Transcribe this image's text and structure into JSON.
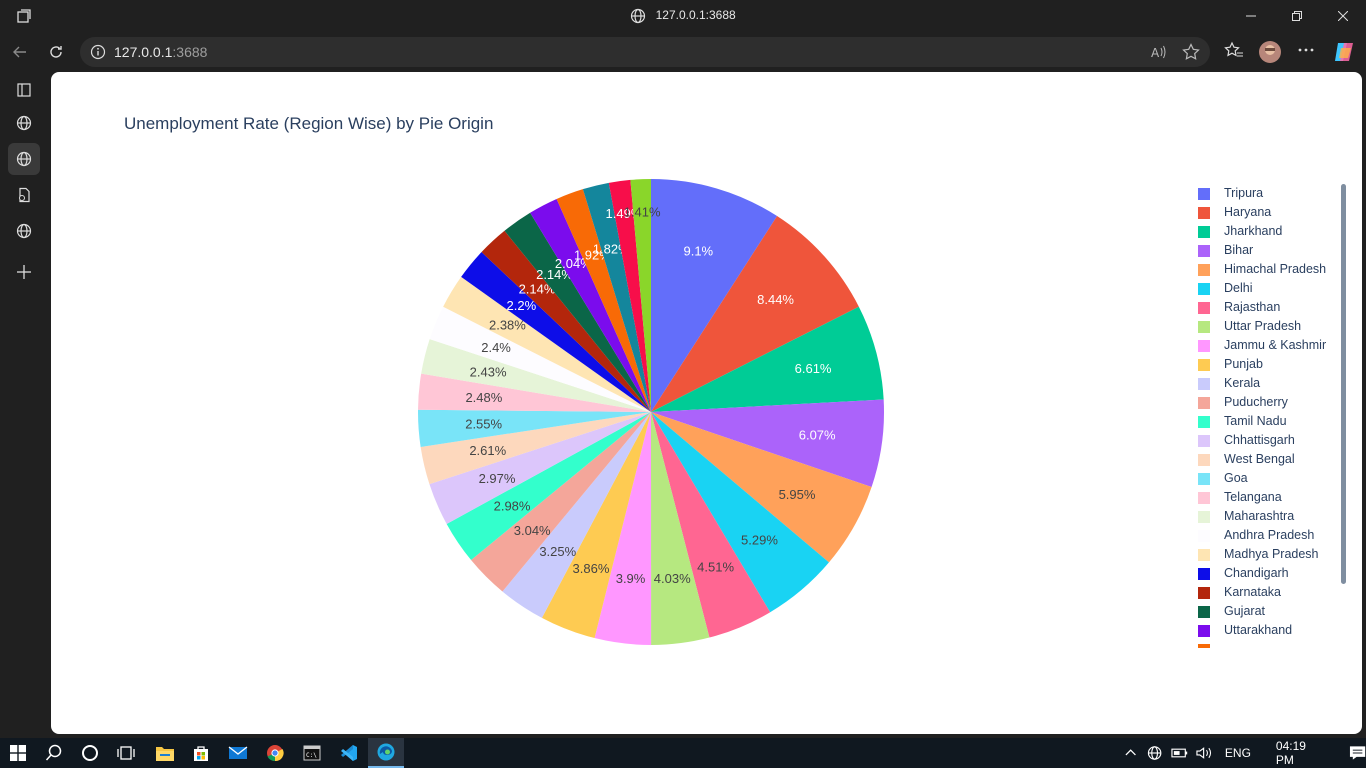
{
  "window": {
    "title": "127.0.0.1:3688"
  },
  "address_bar": {
    "url_host": "127.0.0.1",
    "url_port": ":3688"
  },
  "chart_data": {
    "type": "pie",
    "title": "Unemployment Rate (Region Wise) by Pie Origin",
    "slices": [
      {
        "label": "Tripura",
        "value": 9.1,
        "text": "9.1%",
        "color": "#636efa"
      },
      {
        "label": "Haryana",
        "value": 8.44,
        "text": "8.44%",
        "color": "#ef553b"
      },
      {
        "label": "Jharkhand",
        "value": 6.61,
        "text": "6.61%",
        "color": "#00cc96"
      },
      {
        "label": "Bihar",
        "value": 6.07,
        "text": "6.07%",
        "color": "#ab63fa"
      },
      {
        "label": "Himachal Pradesh",
        "value": 5.95,
        "text": "5.95%",
        "color": "#ffa15a"
      },
      {
        "label": "Delhi",
        "value": 5.29,
        "text": "5.29%",
        "color": "#19d3f3"
      },
      {
        "label": "Rajasthan",
        "value": 4.51,
        "text": "4.51%",
        "color": "#ff6692"
      },
      {
        "label": "Uttar Pradesh",
        "value": 4.03,
        "text": "4.03%",
        "color": "#b6e880"
      },
      {
        "label": "Jammu & Kashmir",
        "value": 3.9,
        "text": "3.9%",
        "color": "#ff97ff"
      },
      {
        "label": "Punjab",
        "value": 3.86,
        "text": "3.86%",
        "color": "#fecb52"
      },
      {
        "label": "Kerala",
        "value": 3.25,
        "text": "3.25%",
        "color": "#c9cbfc"
      },
      {
        "label": "Puducherry",
        "value": 3.04,
        "text": "3.04%",
        "color": "#f4a69a"
      },
      {
        "label": "Tamil Nadu",
        "value": 2.98,
        "text": "2.98%",
        "color": "#33ffcc"
      },
      {
        "label": "Chhattisgarh",
        "value": 2.97,
        "text": "2.97%",
        "color": "#dcc6fb"
      },
      {
        "label": "West Bengal",
        "value": 2.61,
        "text": "2.61%",
        "color": "#fdd8bd"
      },
      {
        "label": "Goa",
        "value": 2.55,
        "text": "2.55%",
        "color": "#79e4f8"
      },
      {
        "label": "Telangana",
        "value": 2.48,
        "text": "2.48%",
        "color": "#ffc6d6"
      },
      {
        "label": "Maharashtra",
        "value": 2.43,
        "text": "2.43%",
        "color": "#e6f4d8"
      },
      {
        "label": "Andhra Pradesh",
        "value": 2.4,
        "text": "2.4%",
        "color": "#fdfcff"
      },
      {
        "label": "Madhya Pradesh",
        "value": 2.38,
        "text": "2.38%",
        "color": "#fee5b3"
      },
      {
        "label": "Chandigarh",
        "value": 2.2,
        "text": "2.2%",
        "color": "#0d0de8"
      },
      {
        "label": "Karnataka",
        "value": 2.14,
        "text": "2.14%",
        "color": "#b3260c"
      },
      {
        "label": "Gujarat",
        "value": 2.14,
        "text": "2.14%",
        "color": "#0b6648"
      },
      {
        "label": "Uttarakhand",
        "value": 2.04,
        "text": "2.04%",
        "color": "#7b0ced"
      },
      {
        "label": "",
        "value": 1.92,
        "text": "1.92%",
        "color": "#f86a06"
      },
      {
        "label": "",
        "value": 1.82,
        "text": "1.82%",
        "color": "#14869c"
      },
      {
        "label": "",
        "value": 1.49,
        "text": "1.49%",
        "color": "#f70e4a"
      },
      {
        "label": "",
        "value": 1.41,
        "text": "1.41%",
        "color": "#8ad62a"
      }
    ]
  },
  "taskbar": {
    "lang": "ENG",
    "time": "04:19 PM"
  }
}
